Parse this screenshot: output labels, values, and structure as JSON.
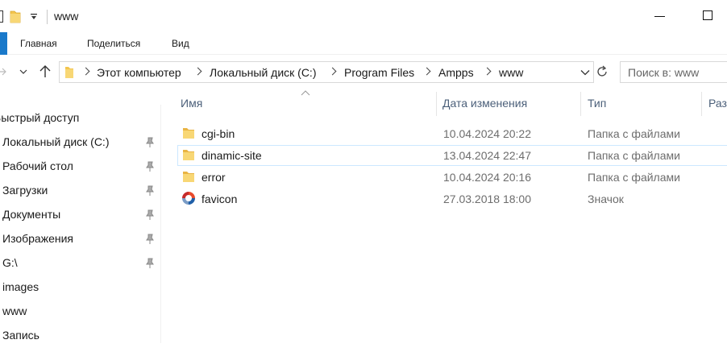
{
  "window": {
    "title": "www"
  },
  "ribbon": {
    "tabs": [
      "Главная",
      "Поделиться",
      "Вид"
    ]
  },
  "address": {
    "crumbs": [
      "Этот компьютер",
      "Локальный диск (C:)",
      "Program Files",
      "Ampps",
      "www"
    ]
  },
  "search": {
    "placeholder": "Поиск в: www"
  },
  "sidebar": {
    "items": [
      {
        "label": "Быстрый доступ",
        "pinned": false
      },
      {
        "label": "Локальный диск (C:)",
        "pinned": true
      },
      {
        "label": "Рабочий стол",
        "pinned": true
      },
      {
        "label": "Загрузки",
        "pinned": true
      },
      {
        "label": "Документы",
        "pinned": true
      },
      {
        "label": "Изображения",
        "pinned": true
      },
      {
        "label": "G:\\",
        "pinned": true
      },
      {
        "label": "images",
        "pinned": false
      },
      {
        "label": "www",
        "pinned": false
      },
      {
        "label": "Запись",
        "pinned": false
      }
    ]
  },
  "columns": {
    "name": "Имя",
    "date": "Дата изменения",
    "type": "Тип",
    "size": "Раз"
  },
  "files": [
    {
      "name": "cgi-bin",
      "date": "10.04.2024 20:22",
      "type": "Папка с файлами",
      "icon": "folder-icon",
      "selected": false
    },
    {
      "name": "dinamic-site",
      "date": "13.04.2024 22:47",
      "type": "Папка с файлами",
      "icon": "folder-icon",
      "selected": true
    },
    {
      "name": "error",
      "date": "10.04.2024 20:16",
      "type": "Папка с файлами",
      "icon": "folder-icon",
      "selected": false
    },
    {
      "name": "favicon",
      "date": "27.03.2018 18:00",
      "type": "Значок",
      "icon": "ampps-favicon-icon",
      "selected": false
    }
  ],
  "colors": {
    "accent": "#1979ca",
    "folder": "#f8d775",
    "selection_border": "#cce8ff",
    "header_text": "#4c607a"
  }
}
